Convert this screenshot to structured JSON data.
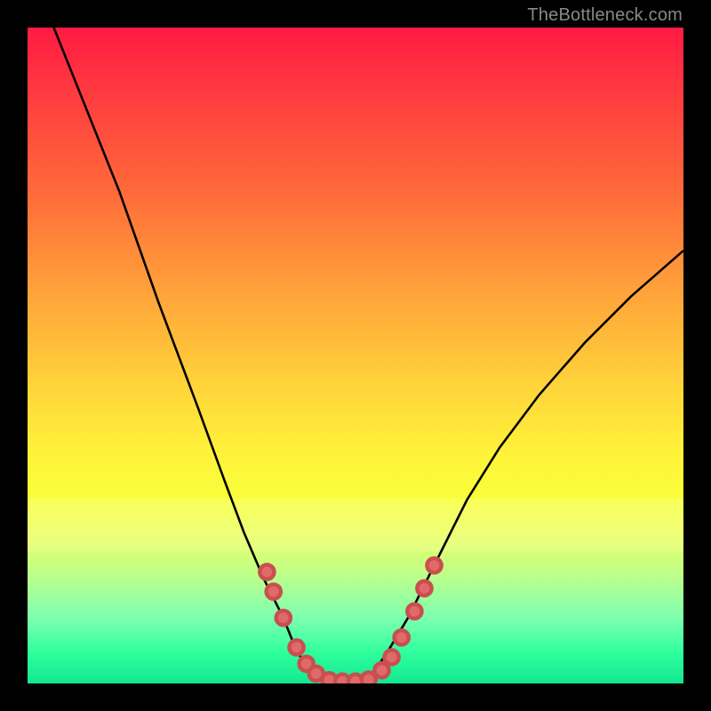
{
  "watermark": "TheBottleneck.com",
  "chart_data": {
    "type": "line",
    "title": "",
    "xlabel": "",
    "ylabel": "",
    "xlim": [
      0,
      100
    ],
    "ylim": [
      0,
      100
    ],
    "grid": false,
    "legend": false,
    "series": [
      {
        "name": "bottleneck-curve",
        "x": [
          4,
          8,
          14,
          20,
          26,
          30,
          33,
          36,
          39,
          41,
          43,
          45,
          47,
          49,
          51,
          53,
          55,
          58,
          61,
          64,
          67,
          72,
          78,
          85,
          92,
          100
        ],
        "y": [
          100,
          90,
          75,
          58,
          42,
          31,
          23,
          16,
          10,
          5,
          2,
          0.5,
          0,
          0,
          0.5,
          2,
          5,
          10,
          16,
          22,
          28,
          36,
          44,
          52,
          59,
          66
        ]
      }
    ],
    "markers": {
      "name": "highlight-dots",
      "x": [
        36.5,
        37.5,
        39,
        41,
        42.5,
        44,
        46,
        48,
        50,
        52,
        54,
        55.5,
        57,
        59,
        60.5,
        62
      ],
      "y": [
        17,
        14,
        10,
        5.5,
        3,
        1.5,
        0.5,
        0.3,
        0.3,
        0.6,
        2,
        4,
        7,
        11,
        14.5,
        18
      ]
    },
    "background_gradient": {
      "top": "#ff1a44",
      "mid": "#ffe23a",
      "bottom": "#12e892"
    }
  }
}
